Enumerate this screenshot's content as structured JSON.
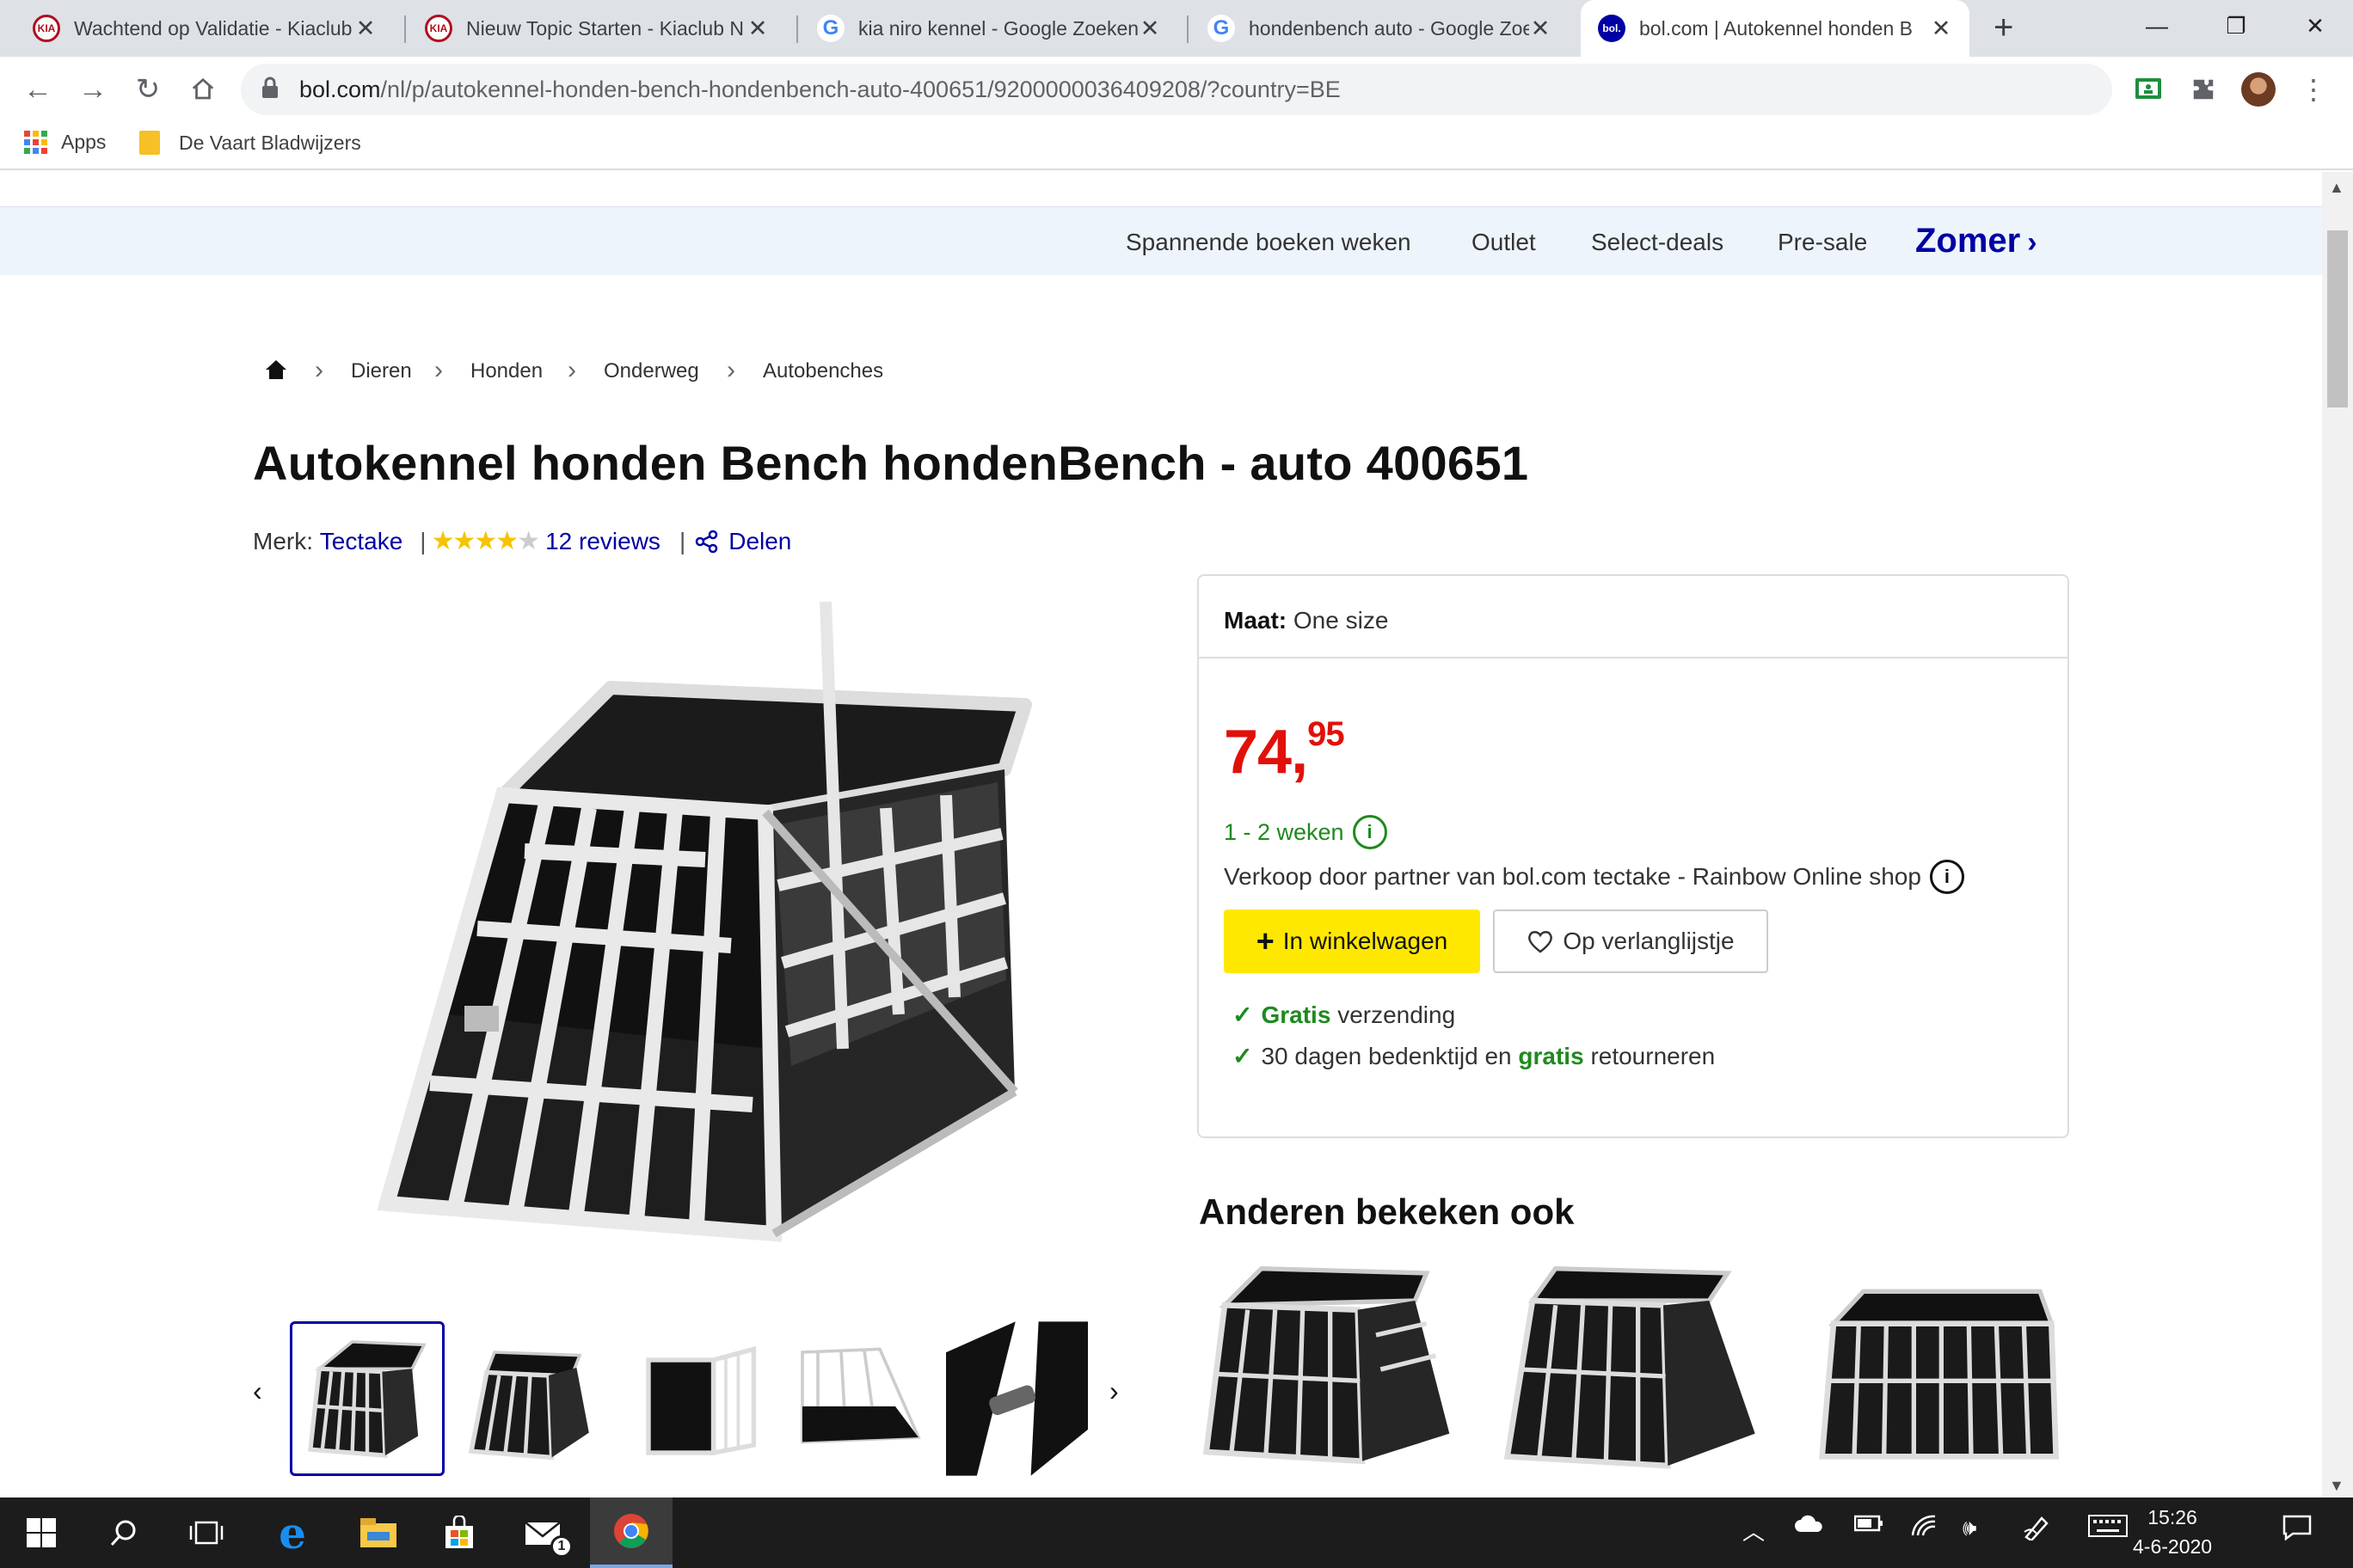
{
  "browser": {
    "tabs": [
      {
        "title": "Wachtend op Validatie - Kiaclub",
        "favicon": "kia-logo-icon"
      },
      {
        "title": "Nieuw Topic Starten - Kiaclub N",
        "favicon": "kia-logo-icon"
      },
      {
        "title": "kia niro kennel - Google Zoeken",
        "favicon": "google-icon"
      },
      {
        "title": "hondenbench auto - Google Zoe",
        "favicon": "google-icon"
      },
      {
        "title": "bol.com | Autokennel honden B",
        "favicon": "bol-logo-icon",
        "active": true
      }
    ],
    "favicon_text": {
      "kia": "KIA",
      "google": "G",
      "bol": "bol."
    },
    "url_host": "bol.com",
    "url_path": "/nl/p/autokennel-honden-bench-hondenbench-auto-400651/9200000036409208/?country=BE",
    "bookmarks": [
      {
        "label": "Apps",
        "icon": "apps-grid-icon"
      },
      {
        "label": "De Vaart Bladwijzers",
        "icon": "folder-icon"
      }
    ]
  },
  "site": {
    "promo_links": [
      "Spannende boeken weken",
      "Outlet",
      "Select-deals",
      "Pre-sale"
    ],
    "promo_highlight": "Zomer",
    "brand_color": "#0000a4",
    "breadcrumbs": [
      "Dieren",
      "Honden",
      "Onderweg",
      "Autobenches"
    ]
  },
  "product": {
    "title": "Autokennel honden Bench hondenBench - auto 400651",
    "brand_label": "Merk:",
    "brand": "Tectake",
    "rating": 4,
    "rating_max": 5,
    "reviews": "12 reviews",
    "share": "Delen",
    "size_label": "Maat:",
    "size": "One size",
    "price_main": "74,",
    "price_cents": "95",
    "price_color": "#e0110a",
    "delivery": "1 - 2 weken",
    "seller": "Verkoop door partner van bol.com tectake - Rainbow Online shop",
    "cart_button": "In winkelwagen",
    "wishlist_button": "Op verlanglijstje",
    "usp1_bold": "Gratis",
    "usp1_rest": "verzending",
    "usp2_pre": "30 dagen bedenktijd en",
    "usp2_bold": "gratis",
    "usp2_post": "retourneren",
    "thumbnail_count": 5,
    "selected_thumbnail": 1
  },
  "also_viewed": {
    "heading": "Anderen bekeken ook"
  },
  "taskbar": {
    "time": "15:26",
    "date": "4-6-2020",
    "mail_badge": "1"
  }
}
